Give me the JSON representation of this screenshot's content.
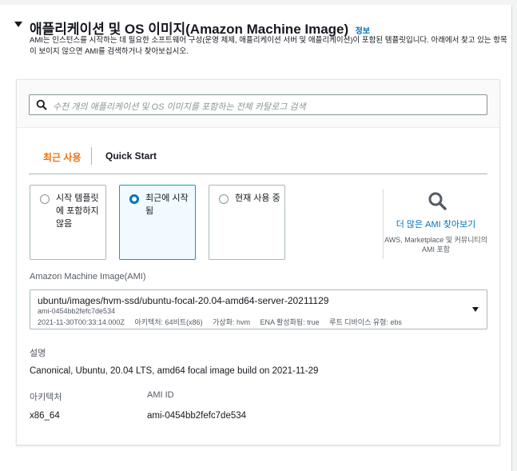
{
  "section": {
    "title": "애플리케이션 및 OS 이미지(Amazon Machine Image)",
    "info": "정보",
    "description": "AMI는 인스턴스를 시작하는 데 필요한 소프트웨어 구성(운영 체제, 애플리케이션 서버 및 애플리케이션)이 포함된 템플릿입니다. 아래에서 찾고 있는 항목이 보이지 않으면 AMI를 검색하거나 찾아보십시오."
  },
  "search": {
    "placeholder": "수천 개의 애플리케이션 및 OS 이미지를 포함하는 전체 카탈로그 검색",
    "icon": "search-icon"
  },
  "tabs": [
    {
      "label": "최근 사용",
      "active": true
    },
    {
      "label": "Quick Start",
      "active": false
    }
  ],
  "tiles": [
    {
      "label": "시작 템플릿에 포함하지 않음",
      "selected": false
    },
    {
      "label": "최근에 시작됨",
      "selected": true
    },
    {
      "label": "현재 사용 중",
      "selected": false
    }
  ],
  "browse_more": {
    "link": "더 많은 AMI 찾아보기",
    "subtext": "AWS, Marketplace 및 커뮤니티의 AMI 포함",
    "icon": "search-icon"
  },
  "ami": {
    "label": "Amazon Machine Image(AMI)",
    "name": "ubuntu/images/hvm-ssd/ubuntu-focal-20.04-amd64-server-20211129",
    "id": "ami-0454bb2fefc7de534",
    "date": "2021-11-30T00:33:14.000Z",
    "architecture": "아키텍처: 64비트(x86)",
    "virtualization": "가상화: hvm",
    "ena": "ENA 활성화됨: true",
    "root_device": "루트 디바이스 유형: ebs"
  },
  "details": {
    "description_label": "설명",
    "description_value": "Canonical, Ubuntu, 20.04 LTS, amd64 focal image build on 2021-11-29",
    "architecture_label": "아키텍처",
    "architecture_value": "x86_64",
    "ami_id_label": "AMI ID",
    "ami_id_value": "ami-0454bb2fefc7de534"
  },
  "colors": {
    "accent_orange": "#ec7211",
    "link_blue": "#0073bb",
    "selected_border": "#00a1c9"
  }
}
